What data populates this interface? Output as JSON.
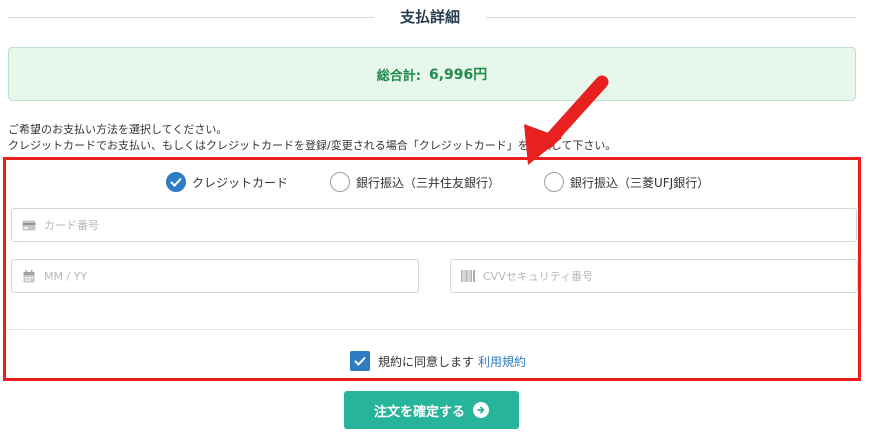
{
  "header": {
    "title": "支払詳細"
  },
  "total": {
    "label": "総合計:",
    "amount": "6,996円"
  },
  "instructions": {
    "line1": "ご希望のお支払い方法を選択してください。",
    "line2": "クレジットカードでお支払い、もしくはクレジットカードを登録/変更される場合「クレジットカード」を選択して下さい。"
  },
  "payment_methods": [
    {
      "label": "クレジットカード",
      "checked": true
    },
    {
      "label": "銀行振込（三井住友銀行）",
      "checked": false
    },
    {
      "label": "銀行振込（三菱UFJ銀行）",
      "checked": false
    }
  ],
  "fields": {
    "card_number": {
      "placeholder": "カード番号",
      "icon": "credit-card-icon"
    },
    "expiry": {
      "placeholder": "MM / YY",
      "icon": "calendar-icon"
    },
    "cvv": {
      "placeholder": "CVVセキュリティ番号",
      "icon": "barcode-icon"
    }
  },
  "agreement": {
    "text": "規約に同意します",
    "link": "利用規約",
    "checked": true
  },
  "confirm_button": {
    "label": "注文を確定する",
    "icon": "arrow-right-circle-icon"
  },
  "colors": {
    "accent": "#2e7cc4",
    "total_text": "#1e8a4c",
    "total_bg": "#e7f7ec",
    "button": "#28b49a",
    "highlight_border": "#e8201f"
  }
}
